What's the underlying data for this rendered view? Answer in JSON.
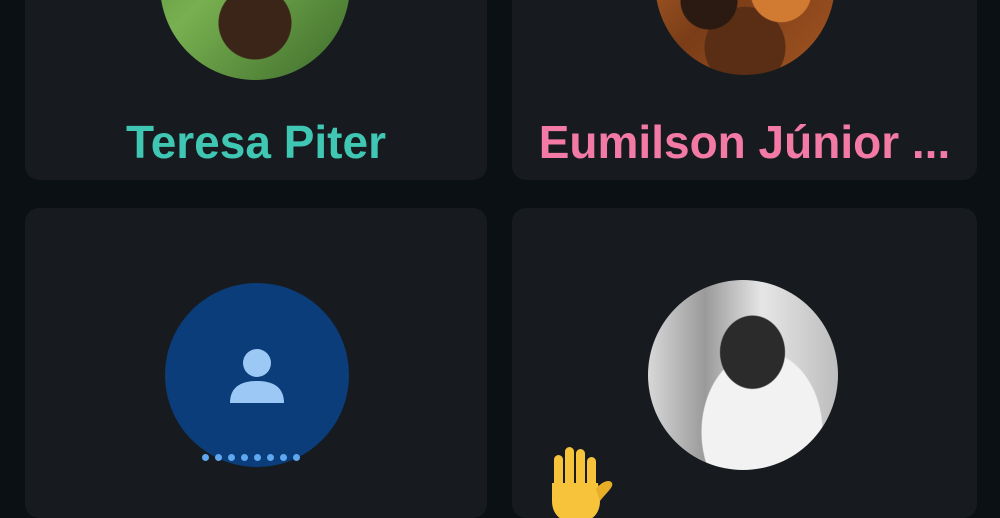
{
  "participants": [
    {
      "name": "Teresa Piter",
      "name_color": "#3fc7b3",
      "avatar": "photo"
    },
    {
      "name": "Eumilson Júnior ...",
      "name_color": "#f27aa5",
      "avatar": "photo"
    },
    {
      "name": "",
      "avatar": "default-person-icon",
      "avatar_color": "#0a3d7a",
      "status": "connecting"
    },
    {
      "name": "",
      "avatar": "photo",
      "reaction": "raised-hand-emoji"
    }
  ],
  "colors": {
    "background": "#0b1014",
    "tile": "#171b1f",
    "loading_dots": "#5fa8f0",
    "hand": "#f6c33b"
  }
}
